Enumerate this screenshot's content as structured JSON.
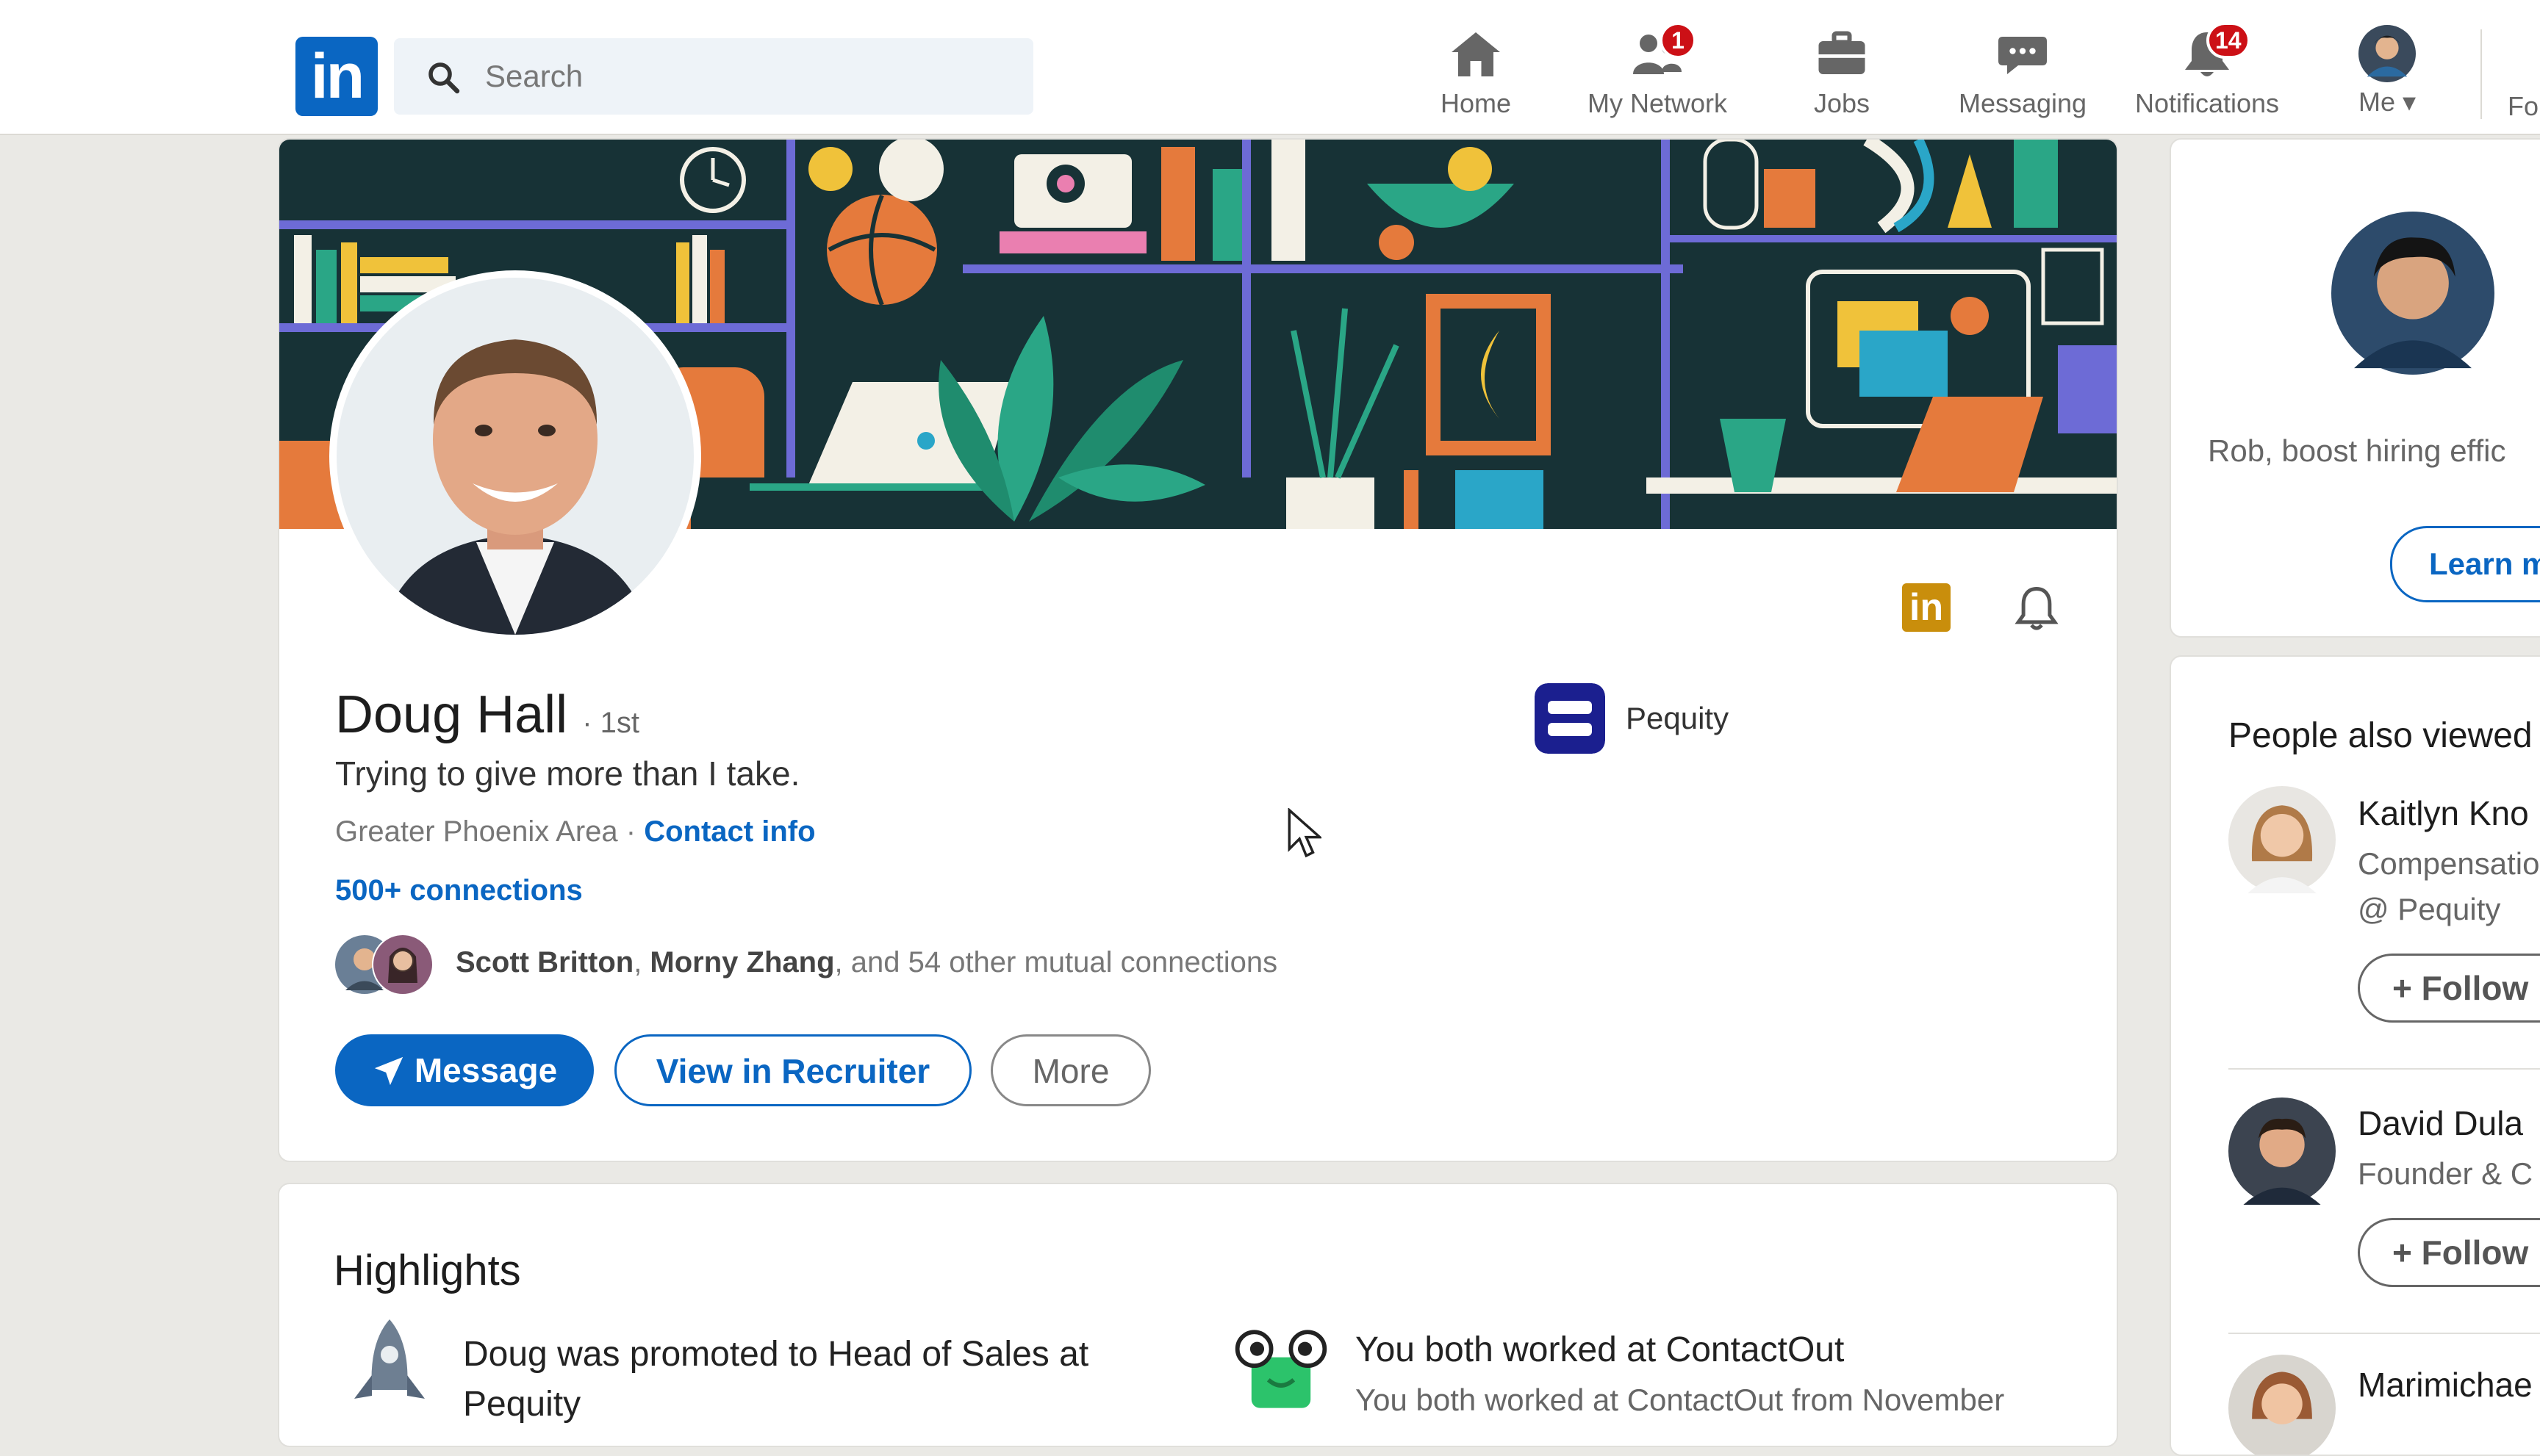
{
  "topbar": {
    "logo_text": "in",
    "search_placeholder": "Search",
    "nav": [
      {
        "label": "Home",
        "icon": "home-icon",
        "badge": ""
      },
      {
        "label": "My Network",
        "icon": "network-icon",
        "badge": "1"
      },
      {
        "label": "Jobs",
        "icon": "briefcase-icon",
        "badge": ""
      },
      {
        "label": "Messaging",
        "icon": "chat-icon",
        "badge": ""
      },
      {
        "label": "Notifications",
        "icon": "bell-icon",
        "badge": "14"
      },
      {
        "label": "Me ▾",
        "icon": "avatar-icon",
        "badge": ""
      }
    ],
    "truncated_item": "Fo"
  },
  "profile": {
    "name": "Doug Hall",
    "degree": "· 1st",
    "headline": "Trying to give more than I take.",
    "location": "Greater Phoenix Area ·",
    "contact_link": "Contact info",
    "connections": "500+ connections",
    "mutual": {
      "name1": "Scott Britton",
      "sep": ", ",
      "name2": "Morny Zhang",
      "rest": ", and 54 other mutual connections"
    },
    "buttons": {
      "message": "Message",
      "recruiter": "View in Recruiter",
      "more": "More"
    },
    "company": "Pequity",
    "badge_text": "in"
  },
  "highlights": {
    "title": "Highlights",
    "item1": "Doug was promoted to Head of Sales at Pequity",
    "item2_title": "You both worked at ContactOut",
    "item2_sub": "You both worked at ContactOut from November"
  },
  "sidebar": {
    "promo_text": "Rob, boost hiring effic",
    "promo_button": "Learn m",
    "also_viewed_title": "People also viewed",
    "people": [
      {
        "name": "Kaitlyn Kno",
        "line1": "Compensatio",
        "line2": "@ Pequity",
        "follow": "Follow"
      },
      {
        "name": "David Dula",
        "line1": "Founder & C",
        "line2": "",
        "follow": "Follow"
      },
      {
        "name": "Marimichae",
        "line1": "",
        "line2": "",
        "follow": ""
      }
    ]
  },
  "colors": {
    "brand": "#0a66c2",
    "badge_red": "#cc1016",
    "premium_gold": "#c98e0c",
    "pequity_navy": "#1b1f8f"
  }
}
